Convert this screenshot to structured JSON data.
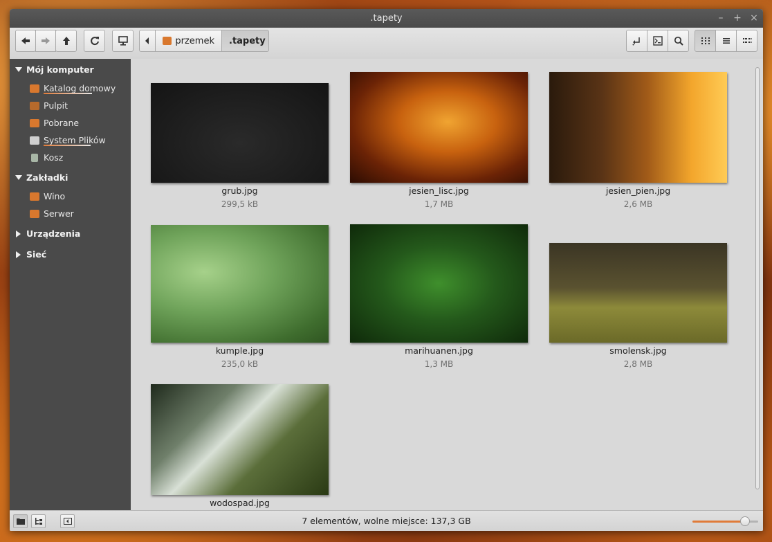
{
  "window": {
    "title": ".tapety"
  },
  "wm": {
    "minimize": "–",
    "maximize": "+",
    "close": "×"
  },
  "breadcrumb": [
    {
      "label": "przemek",
      "active": false
    },
    {
      "label": ".tapety",
      "active": true
    }
  ],
  "sidebar": {
    "sections": [
      {
        "title": "Mój komputer",
        "expanded": true,
        "items": [
          {
            "label": "Katalog domowy",
            "icon": "home-folder-icon"
          },
          {
            "label": "Pulpit",
            "icon": "desktop-folder-icon"
          },
          {
            "label": "Pobrane",
            "icon": "downloads-folder-icon"
          },
          {
            "label": "System Plików",
            "icon": "drive-icon"
          },
          {
            "label": "Kosz",
            "icon": "trash-icon"
          }
        ]
      },
      {
        "title": "Zakładki",
        "expanded": true,
        "items": [
          {
            "label": "Wino",
            "icon": "folder-icon"
          },
          {
            "label": "Serwer",
            "icon": "folder-icon"
          }
        ]
      },
      {
        "title": "Urządzenia",
        "expanded": false,
        "items": []
      },
      {
        "title": "Sieć",
        "expanded": false,
        "items": []
      }
    ]
  },
  "files": [
    {
      "name": "grub.jpg",
      "size": "299,5 kB"
    },
    {
      "name": "jesien_lisc.jpg",
      "size": "1,7 MB"
    },
    {
      "name": "jesien_pien.jpg",
      "size": "2,6 MB"
    },
    {
      "name": "kumple.jpg",
      "size": "235,0 kB"
    },
    {
      "name": "marihuanen.jpg",
      "size": "1,3 MB"
    },
    {
      "name": "smolensk.jpg",
      "size": "2,8 MB"
    },
    {
      "name": "wodospad.jpg",
      "size": ""
    }
  ],
  "status": {
    "text": "7 elementów, wolne miejsce: 137,3 GB"
  },
  "zoom": {
    "level": 0.8
  },
  "colors": {
    "accent": "#e07b39",
    "sidebar_bg": "#4a4a4a",
    "content_bg": "#d9d9d9"
  }
}
